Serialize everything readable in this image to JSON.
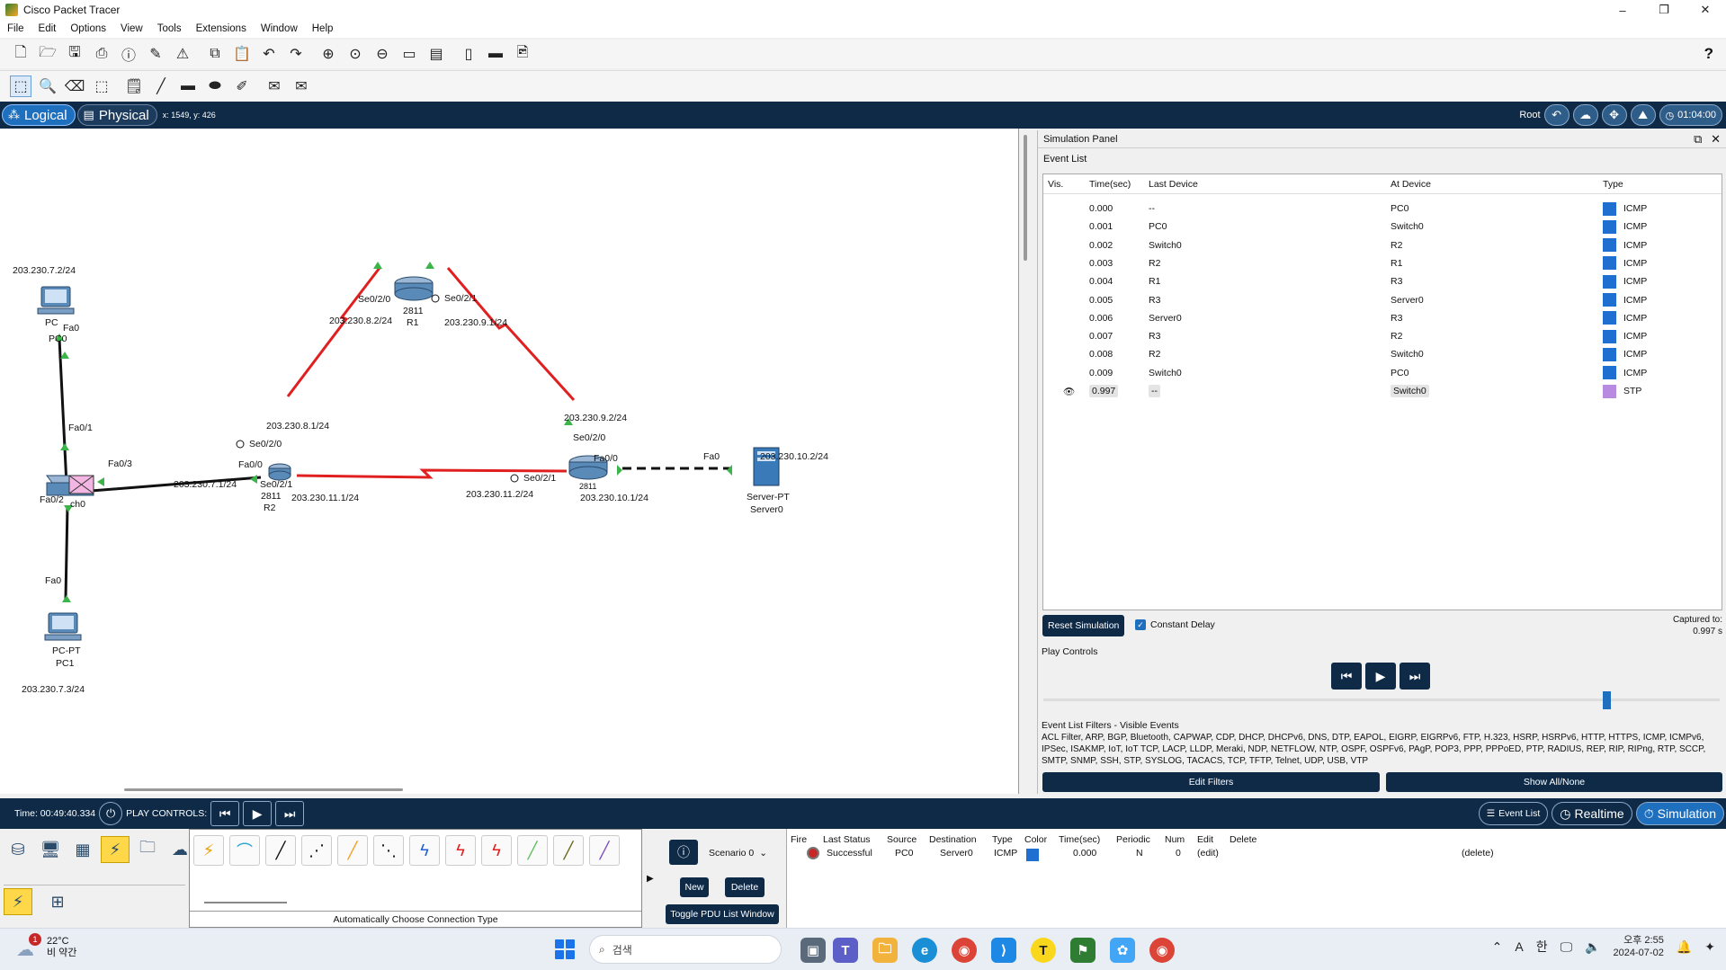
{
  "window": {
    "title": "Cisco Packet Tracer",
    "minimize": "–",
    "maximize": "❐",
    "close": "✕"
  },
  "menu": [
    "File",
    "Edit",
    "Options",
    "View",
    "Tools",
    "Extensions",
    "Window",
    "Help"
  ],
  "modebar": {
    "logical_label": "Logical",
    "physical_label": "Physical",
    "coords": "x: 1549, y: 426",
    "root_label": "Root",
    "time": "01:04:00"
  },
  "topology": {
    "labels": {
      "pc0_ip": "203.230.7.2/24",
      "pc0_short": "PC",
      "pc0_fa0": "Fa0",
      "pc0_name": "PC0",
      "sw_fa0_1": "Fa0/1",
      "sw_fa0_3": "Fa0/3",
      "sw_fa0_2": "Fa0/2",
      "sw_name": "ch0",
      "sw_fa0_pc1": "Fa0",
      "pc1_type": "PC-PT",
      "pc1_name": "PC1",
      "pc1_ip": "203.230.7.3/24",
      "r1_se020": "Se0/2/0",
      "r1_se021": "Se0/2/1",
      "r1_model": "2811",
      "r1_name": "R1",
      "r1_ip_left": "203.230.8.2/24",
      "r1_ip_right": "203.230.9.1/24",
      "r2_ip_top": "203.230.8.1/24",
      "r2_se020": "Se0/2/0",
      "r2_fa00": "Fa0/0",
      "r2_ip_lan": "203.230.7.1/24",
      "r2_se021": "Se0/2/1",
      "r2_model": "2811",
      "r2_name": "R2",
      "r2_ip_bottom": "203.230.11.1/24",
      "r3_ip_top": "203.230.9.2/24",
      "r3_se020": "Se0/2/0",
      "r3_fa00": "Fa0/0",
      "r3_se021": "Se0/2/1",
      "r3_ip_left": "203.230.11.2/24",
      "r3_ip_lan": "203.230.10.1/24",
      "r3_model": "2811",
      "srv_fa0": "Fa0",
      "srv_ip": "203.230.10.2/24",
      "srv_type": "Server-PT",
      "srv_name": "Server0"
    }
  },
  "simulation_panel": {
    "title": "Simulation Panel",
    "event_list_title": "Event List",
    "columns": {
      "vis": "Vis.",
      "time": "Time(sec)",
      "last": "Last Device",
      "at": "At Device",
      "type": "Type"
    },
    "events": [
      {
        "time": "0.000",
        "last": "--",
        "at": "PC0",
        "type": "ICMP",
        "color": "#1f6fd0"
      },
      {
        "time": "0.001",
        "last": "PC0",
        "at": "Switch0",
        "type": "ICMP",
        "color": "#1f6fd0"
      },
      {
        "time": "0.002",
        "last": "Switch0",
        "at": "R2",
        "type": "ICMP",
        "color": "#1f6fd0"
      },
      {
        "time": "0.003",
        "last": "R2",
        "at": "R1",
        "type": "ICMP",
        "color": "#1f6fd0"
      },
      {
        "time": "0.004",
        "last": "R1",
        "at": "R3",
        "type": "ICMP",
        "color": "#1f6fd0"
      },
      {
        "time": "0.005",
        "last": "R3",
        "at": "Server0",
        "type": "ICMP",
        "color": "#1f6fd0"
      },
      {
        "time": "0.006",
        "last": "Server0",
        "at": "R3",
        "type": "ICMP",
        "color": "#1f6fd0"
      },
      {
        "time": "0.007",
        "last": "R3",
        "at": "R2",
        "type": "ICMP",
        "color": "#1f6fd0"
      },
      {
        "time": "0.008",
        "last": "R2",
        "at": "Switch0",
        "type": "ICMP",
        "color": "#1f6fd0"
      },
      {
        "time": "0.009",
        "last": "Switch0",
        "at": "PC0",
        "type": "ICMP",
        "color": "#1f6fd0"
      },
      {
        "time": "0.997",
        "last": "--",
        "at": "Switch0",
        "type": "STP",
        "color": "#b98be0"
      }
    ],
    "reset_label": "Reset Simulation",
    "constant_delay_label": "Constant Delay",
    "captured_label": "Captured to:",
    "captured_value": "0.997 s",
    "play_controls_title": "Play Controls",
    "filters_title": "Event List Filters - Visible Events",
    "filters_text": "ACL Filter, ARP, BGP, Bluetooth, CAPWAP, CDP, DHCP, DHCPv6, DNS, DTP, EAPOL, EIGRP, EIGRPv6, FTP, H.323, HSRP, HSRPv6, HTTP, HTTPS, ICMP, ICMPv6, IPSec, ISAKMP, IoT, IoT TCP, LACP, LLDP, Meraki, NDP, NETFLOW, NTP, OSPF, OSPFv6, PAgP, POP3, PPP, PPPoED, PTP, RADIUS, REP, RIP, RIPng, RTP, SCCP, SMTP, SNMP, SSH, STP, SYSLOG, TACACS, TCP, TFTP, Telnet, UDP, USB, VTP",
    "edit_filters": "Edit Filters",
    "show_all": "Show All/None"
  },
  "bottombar": {
    "time": "Time: 00:49:40.334",
    "play_label": "PLAY CONTROLS:",
    "event_list": "Event List",
    "realtime": "Realtime",
    "simulation": "Simulation"
  },
  "palette": {
    "connection_label": "Automatically Choose Connection Type",
    "scenario": "Scenario 0",
    "new": "New",
    "delete": "Delete",
    "toggle_pdu": "Toggle PDU List Window"
  },
  "pdu_table": {
    "columns": [
      "Fire",
      "Last Status",
      "Source",
      "Destination",
      "Type",
      "Color",
      "Time(sec)",
      "Periodic",
      "Num",
      "Edit",
      "Delete"
    ],
    "row": {
      "status": "Successful",
      "source": "PC0",
      "destination": "Server0",
      "type": "ICMP",
      "time": "0.000",
      "periodic": "N",
      "num": "0",
      "edit": "(edit)",
      "delete": "(delete)"
    },
    "color": "#1f6fd0"
  },
  "taskbar": {
    "weather_badge": "1",
    "temperature": "22°C",
    "weather_desc": "비 약간",
    "search_placeholder": "검색",
    "time": "오후 2:55",
    "date": "2024-07-02",
    "ime_lang": "A",
    "ime_hangul": "한"
  },
  "colors": {
    "navy": "#0e2a47",
    "accent": "#1f6fbf",
    "serial_link": "#e02020",
    "port_up": "#3bb54a"
  }
}
